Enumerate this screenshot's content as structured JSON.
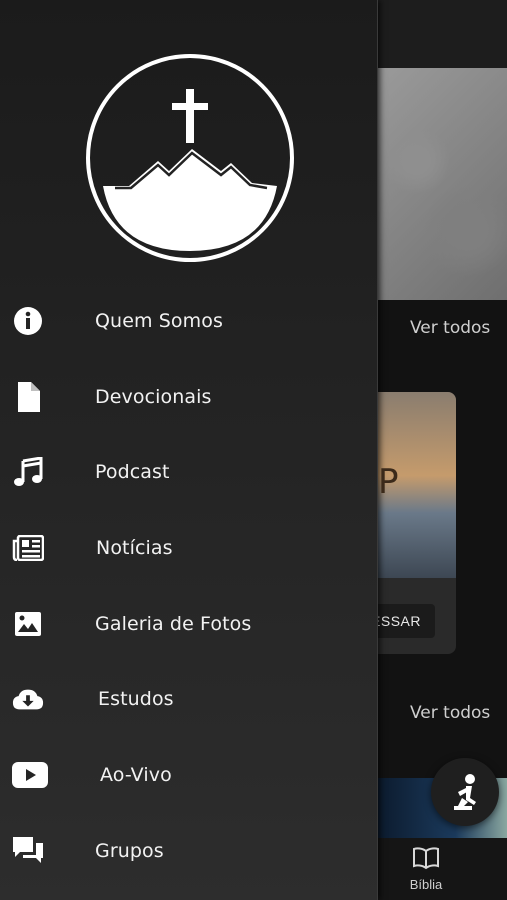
{
  "background": {
    "see_all_1": "Ver todos",
    "see_all_2": "Ver todos",
    "card_title_fragment": "P",
    "card_button": "ESSAR",
    "bottom_nav_bible": "Bíblia"
  },
  "drawer": {
    "logo_icon": "cross-on-mountain-logo",
    "items": [
      {
        "label": "Quem Somos",
        "icon": "info-icon"
      },
      {
        "label": "Devocionais",
        "icon": "document-icon"
      },
      {
        "label": "Podcast",
        "icon": "music-note-icon"
      },
      {
        "label": "Notícias",
        "icon": "newspaper-icon"
      },
      {
        "label": "Galeria de Fotos",
        "icon": "image-icon"
      },
      {
        "label": "Estudos",
        "icon": "cloud-download-icon"
      },
      {
        "label": "Ao-Vivo",
        "icon": "youtube-play-icon"
      },
      {
        "label": "Grupos",
        "icon": "chat-bubbles-icon"
      }
    ]
  }
}
